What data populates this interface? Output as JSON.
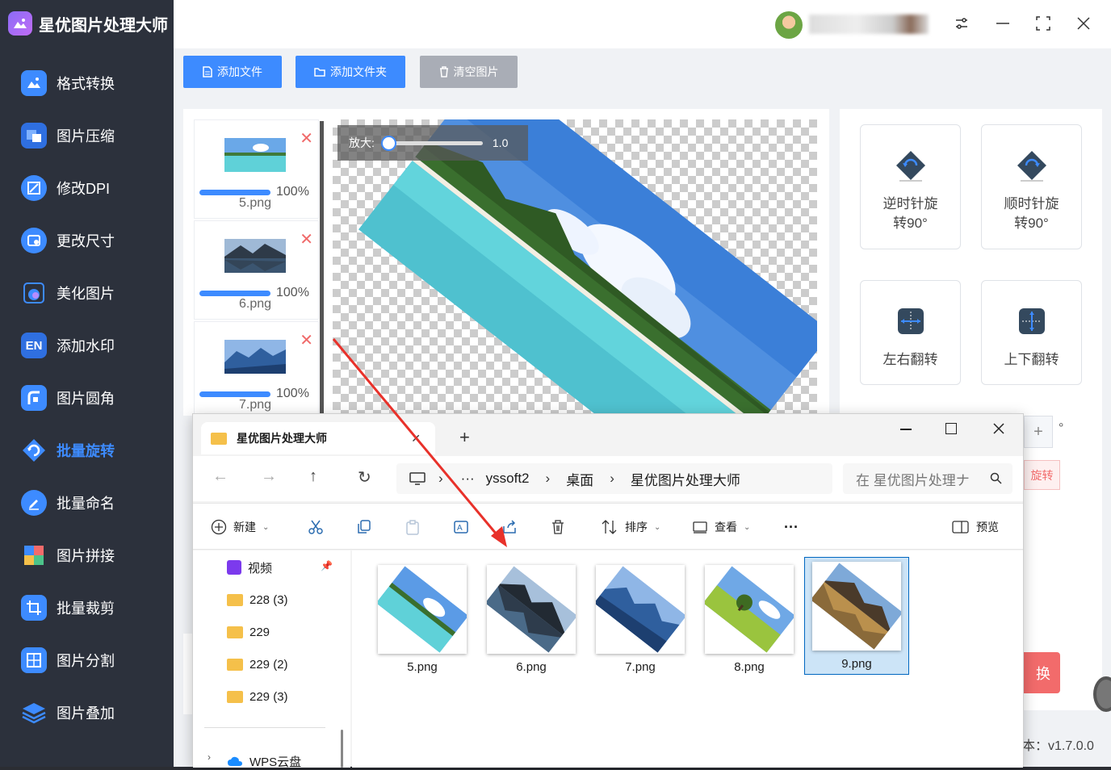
{
  "app": {
    "title": "星优图片处理大师",
    "version": "本：v1.7.0.0",
    "colors": {
      "sidebar": "#2c313c",
      "accent": "#3d8bff",
      "danger": "#f26b6b"
    }
  },
  "sidebar": {
    "items": [
      {
        "label": "格式转换",
        "icon": "image-convert-icon"
      },
      {
        "label": "图片压缩",
        "icon": "compress-icon"
      },
      {
        "label": "修改DPI",
        "icon": "dpi-icon"
      },
      {
        "label": "更改尺寸",
        "icon": "resize-icon"
      },
      {
        "label": "美化图片",
        "icon": "beautify-icon"
      },
      {
        "label": "添加水印",
        "icon": "watermark-icon"
      },
      {
        "label": "图片圆角",
        "icon": "rounded-corner-icon"
      },
      {
        "label": "批量旋转",
        "icon": "rotate-icon",
        "active": true
      },
      {
        "label": "批量命名",
        "icon": "rename-icon"
      },
      {
        "label": "图片拼接",
        "icon": "puzzle-icon"
      },
      {
        "label": "批量裁剪",
        "icon": "crop-icon"
      },
      {
        "label": "图片分割",
        "icon": "split-icon"
      },
      {
        "label": "图片叠加",
        "icon": "layers-icon"
      }
    ]
  },
  "toolbar": {
    "add_file": "添加文件",
    "add_folder": "添加文件夹",
    "clear": "清空图片"
  },
  "files": [
    {
      "name": "5.png",
      "progress_label": "100%",
      "progress": 1.0
    },
    {
      "name": "6.png",
      "progress_label": "100%",
      "progress": 1.0
    },
    {
      "name": "7.png",
      "progress_label": "100%",
      "progress": 1.0
    }
  ],
  "preview": {
    "zoom_label": "放大:",
    "zoom_value": "1.0",
    "zoom_level": 0.05
  },
  "tools": {
    "ccw": "逆时针旋\n转90°",
    "ccw_line1": "逆时针旋",
    "ccw_line2": "转90°",
    "cw_line1": "顺时针旋",
    "cw_line2": "转90°",
    "flip_h": "左右翻转",
    "flip_v": "上下翻转"
  },
  "partial": {
    "plus": "+",
    "degree": "°",
    "rotate_btn": "旋转",
    "convert_btn": "换"
  },
  "explorer": {
    "tab_title": "星优图片处理大师",
    "tab_close": "✕",
    "tab_add": "+",
    "breadcrumb": [
      "yssoft2",
      "桌面",
      "星优图片处理大师"
    ],
    "ellipsis": "···",
    "search_placeholder": "在 星优图片处理ナ",
    "toolbar": {
      "new": "新建",
      "sort": "排序",
      "view": "查看",
      "more": "···",
      "preview": "预览"
    },
    "nav": [
      {
        "label": "视频",
        "type": "video"
      },
      {
        "label": "228 (3)",
        "type": "folder"
      },
      {
        "label": "229",
        "type": "folder"
      },
      {
        "label": "229 (2)",
        "type": "folder"
      },
      {
        "label": "229 (3)",
        "type": "folder"
      },
      {
        "label": "WPS云盘",
        "type": "cloud"
      }
    ],
    "files": [
      {
        "name": "5.png"
      },
      {
        "name": "6.png"
      },
      {
        "name": "7.png"
      },
      {
        "name": "8.png"
      },
      {
        "name": "9.png",
        "selected": true
      }
    ]
  }
}
